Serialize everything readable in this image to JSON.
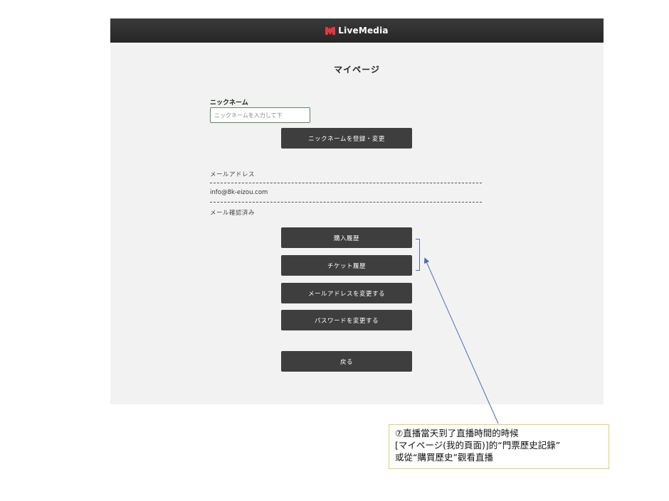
{
  "header": {
    "brand": "LiveMedia",
    "logo_icon": "livemedia-logo-icon",
    "logo_color": "#e4363d"
  },
  "page": {
    "title": "マイページ"
  },
  "nickname": {
    "label": "ニックネーム",
    "placeholder": "ニックネームを入力して下",
    "value": "",
    "submit_label": "ニックネームを登録・変更"
  },
  "account": {
    "email_label": "メールアドレス",
    "email_value": "info@8k-eizou.com",
    "email_status": "メール確認済み"
  },
  "actions": {
    "purchase_history": "購入履歴",
    "ticket_history": "チケット履歴",
    "change_email": "メールアドレスを変更する",
    "change_password": "パスワードを変更する",
    "back": "戻る"
  },
  "annotation": {
    "line1": "⑦直播當天到了直播時間的時候",
    "line2": "[マイページ(我的頁面)]的“門票歷史記錄”",
    "line3": "或從“購買歷史”觀看直播",
    "color": "#4a6fb0"
  }
}
